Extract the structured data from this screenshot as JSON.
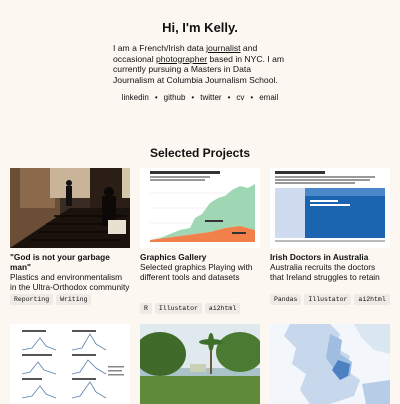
{
  "hero": {
    "title": "Hi, I'm Kelly.",
    "bio_1": "I am a French/Irish data ",
    "bio_link1": "journalist",
    "bio_2": " and occasional ",
    "bio_link2": "photographer",
    "bio_3": " based in NYC. I am currently pursuing a Masters in Data Journalism at Columbia Journalism School."
  },
  "links": [
    "linkedin",
    "github",
    "twitter",
    "cv",
    "email"
  ],
  "section_title": "Selected Projects",
  "cards": [
    {
      "title": "\"God is not your garbage man\"",
      "desc": "Plastics and environmentalism in the Ultra-Orthodox community",
      "tags": [
        "Reporting",
        "Writing"
      ]
    },
    {
      "title": "Graphics Gallery",
      "desc": "Selected graphics Playing with different tools and datasets",
      "tags": [
        "R",
        "Illustator",
        "ai2html"
      ]
    },
    {
      "title": "Irish Doctors in Australia",
      "desc": "Australia recruits the doctors that Ireland struggles to retain",
      "tags": [
        "Pandas",
        "Illustator",
        "ai2html"
      ]
    }
  ],
  "colors": {
    "background": "#fdf7f2",
    "tag_bg": "#efeae6",
    "chart_green": "#9fd6b4",
    "chart_orange": "#f2804a",
    "map_blue": "#1a64b0"
  }
}
